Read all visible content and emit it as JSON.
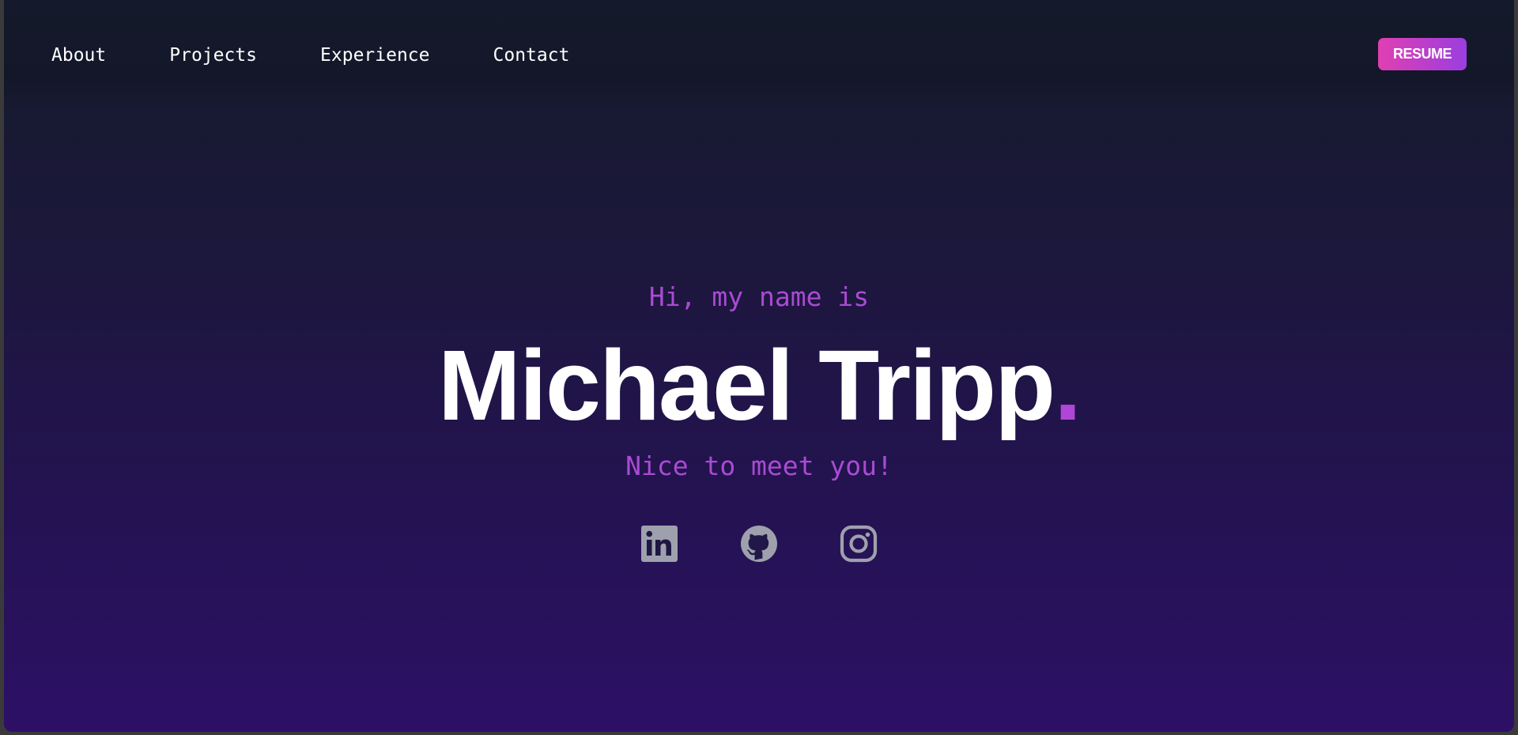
{
  "nav": {
    "links": [
      {
        "label": "About"
      },
      {
        "label": "Projects"
      },
      {
        "label": "Experience"
      },
      {
        "label": "Contact"
      }
    ],
    "resume_label": "RESUME"
  },
  "hero": {
    "greeting": "Hi, my name is",
    "name": "Michael Tripp",
    "name_dot": ".",
    "tagline": "Nice to meet you!"
  },
  "socials": [
    {
      "icon": "linkedin-icon"
    },
    {
      "icon": "github-icon"
    },
    {
      "icon": "instagram-icon"
    }
  ],
  "colors": {
    "accent": "#a94bd2",
    "button_gradient_start": "#e03fb2",
    "button_gradient_end": "#9b3ee0",
    "icon": "#9ea1ad"
  }
}
